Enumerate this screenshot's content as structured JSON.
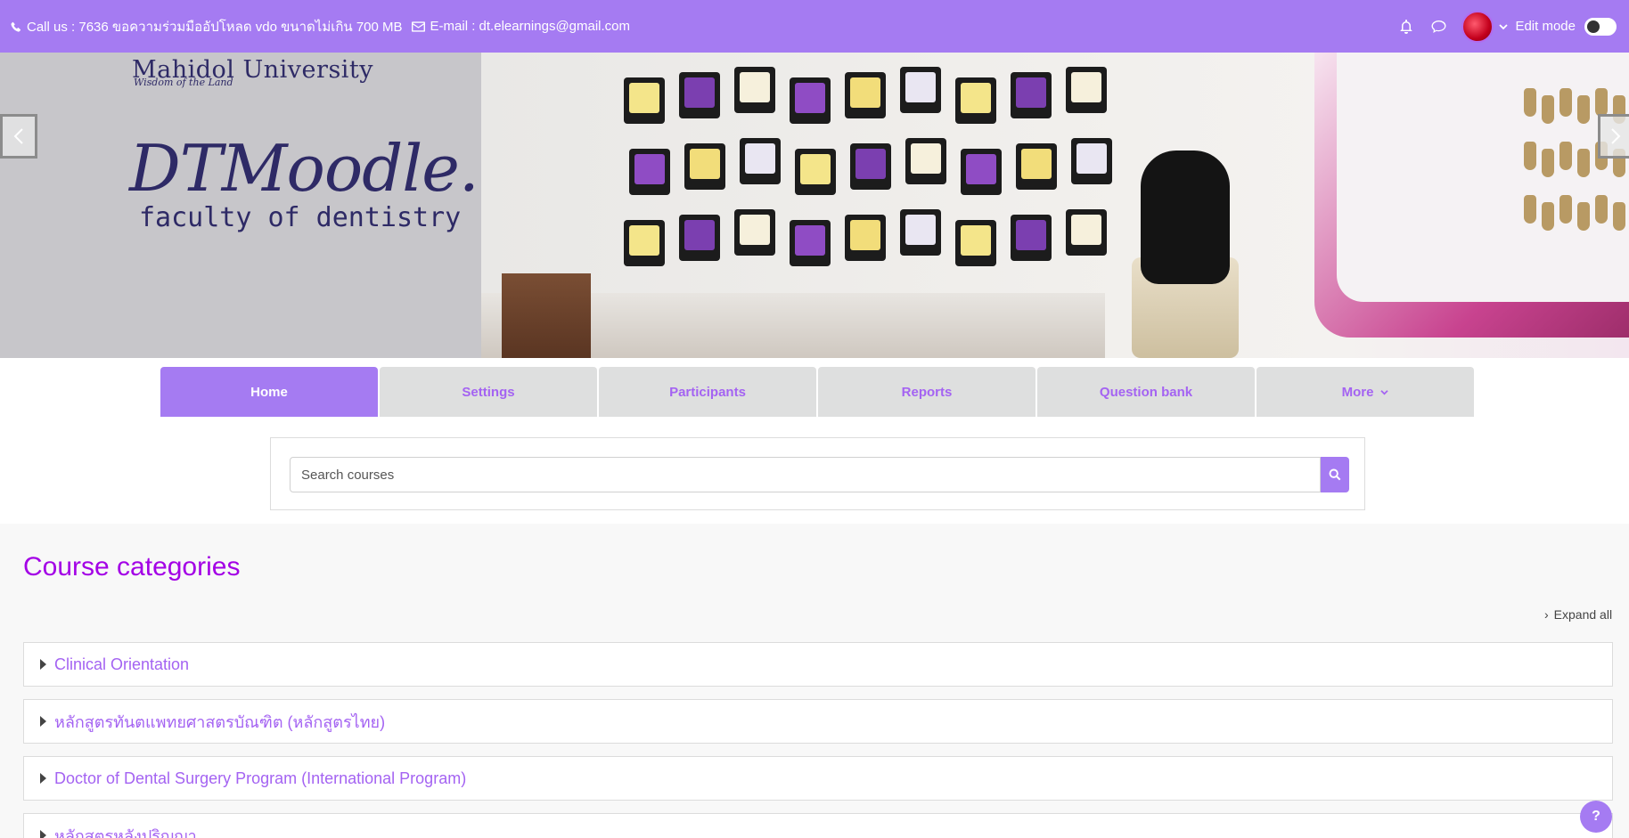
{
  "topbar": {
    "phone_text": "Call us : 7636 ขอความร่วมมืออัปโหลด vdo ขนาดไม่เกิน 700 MB",
    "email_text": "E-mail : dt.elearnings@gmail.com",
    "edit_mode_label": "Edit mode",
    "edit_mode_on": false
  },
  "banner": {
    "university": "Mahidol University",
    "tagline": "Wisdom of the Land",
    "site_name": "DTMoodle.",
    "site_subtitle": "faculty of dentistry"
  },
  "nav": {
    "tabs": [
      {
        "label": "Home",
        "active": true
      },
      {
        "label": "Settings",
        "active": false
      },
      {
        "label": "Participants",
        "active": false
      },
      {
        "label": "Reports",
        "active": false
      },
      {
        "label": "Question bank",
        "active": false
      },
      {
        "label": "More",
        "active": false
      }
    ]
  },
  "search": {
    "placeholder": "Search courses"
  },
  "main": {
    "heading": "Course categories",
    "expand_all_label": "Expand all",
    "categories": [
      {
        "name": "Clinical Orientation"
      },
      {
        "name": "หลักสูตรทันตแพทยศาสตรบัณฑิต (หลักสูตรไทย)"
      },
      {
        "name": "Doctor of Dental Surgery Program (International Program)"
      },
      {
        "name": "หลักสูตรหลังปริญญา"
      }
    ]
  },
  "help_label": "?",
  "colors": {
    "accent": "#a57bf2",
    "heading": "#a300e6",
    "link": "#a463f2"
  }
}
